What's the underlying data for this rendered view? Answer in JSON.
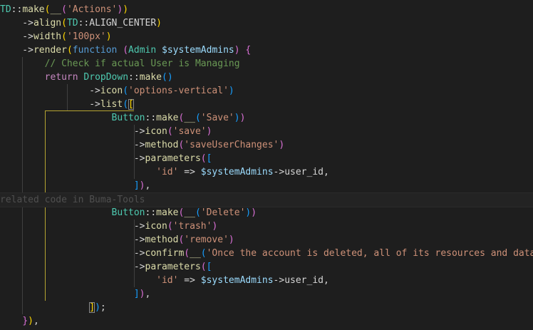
{
  "editor": {
    "language": "php",
    "theme_colors": {
      "background": "#1e1e1e",
      "type": "#4ec9b0",
      "function": "#dcdcaa",
      "string": "#ce9178",
      "variable": "#9cdcfe",
      "keyword": "#c586c0",
      "storage": "#569cd6",
      "comment": "#6a9955",
      "bracket_level_1": "#ffd700",
      "bracket_level_2": "#da70d6",
      "bracket_level_3": "#179fff",
      "active_indent_guide": "#b5a431"
    },
    "codelens_text": "related code in Buma-Tools",
    "lines": [
      [
        [
          "TD",
          "type"
        ],
        [
          "::",
          "op"
        ],
        [
          "make",
          "fn"
        ],
        [
          "(",
          "b1"
        ],
        [
          "__",
          "fn"
        ],
        [
          "(",
          "b2"
        ],
        [
          "'Actions'",
          "str"
        ],
        [
          ")",
          "b2"
        ],
        [
          ")",
          "b1"
        ]
      ],
      [
        [
          "    ->",
          "op"
        ],
        [
          "align",
          "fn"
        ],
        [
          "(",
          "b1"
        ],
        [
          "TD",
          "type"
        ],
        [
          "::ALIGN_CENTER",
          "op"
        ],
        [
          ")",
          "b1"
        ]
      ],
      [
        [
          "    ->",
          "op"
        ],
        [
          "width",
          "fn"
        ],
        [
          "(",
          "b1"
        ],
        [
          "'100px'",
          "str"
        ],
        [
          ")",
          "b1"
        ]
      ],
      [
        [
          "    ->",
          "op"
        ],
        [
          "render",
          "fn"
        ],
        [
          "(",
          "b1"
        ],
        [
          "function",
          "kw2"
        ],
        [
          " ",
          "op"
        ],
        [
          "(",
          "b2"
        ],
        [
          "Admin",
          "type"
        ],
        [
          " ",
          "op"
        ],
        [
          "$systemAdmins",
          "var"
        ],
        [
          ")",
          "b2"
        ],
        [
          " ",
          "op"
        ],
        [
          "{",
          "b2"
        ]
      ],
      [
        [
          "        ",
          "op"
        ],
        [
          "// Check if actual User is Managing",
          "comment"
        ]
      ],
      [
        [
          "        ",
          "op"
        ],
        [
          "return",
          "kw"
        ],
        [
          " ",
          "op"
        ],
        [
          "DropDown",
          "type"
        ],
        [
          "::",
          "op"
        ],
        [
          "make",
          "fn"
        ],
        [
          "(",
          "b3"
        ],
        [
          ")",
          "b3"
        ]
      ],
      [
        [
          "                ->",
          "op"
        ],
        [
          "icon",
          "fn"
        ],
        [
          "(",
          "b3"
        ],
        [
          "'options-vertical'",
          "str"
        ],
        [
          ")",
          "b3"
        ]
      ],
      [
        [
          "                ->",
          "op"
        ],
        [
          "list",
          "fn"
        ],
        [
          "(",
          "b3"
        ],
        [
          "[",
          "b1",
          "match"
        ]
      ],
      [
        [
          "                    ",
          "op"
        ],
        [
          "Button",
          "type"
        ],
        [
          "::",
          "op"
        ],
        [
          "make",
          "fn"
        ],
        [
          "(",
          "b2"
        ],
        [
          "__",
          "fn"
        ],
        [
          "(",
          "b3"
        ],
        [
          "'Save'",
          "str"
        ],
        [
          ")",
          "b3"
        ],
        [
          ")",
          "b2"
        ]
      ],
      [
        [
          "                        ->",
          "op"
        ],
        [
          "icon",
          "fn"
        ],
        [
          "(",
          "b2"
        ],
        [
          "'save'",
          "str"
        ],
        [
          ")",
          "b2"
        ]
      ],
      [
        [
          "                        ->",
          "op"
        ],
        [
          "method",
          "fn"
        ],
        [
          "(",
          "b2"
        ],
        [
          "'saveUserChanges'",
          "str"
        ],
        [
          ")",
          "b2"
        ]
      ],
      [
        [
          "                        ->",
          "op"
        ],
        [
          "parameters",
          "fn"
        ],
        [
          "(",
          "b2"
        ],
        [
          "[",
          "b3"
        ]
      ],
      [
        [
          "                            ",
          "op"
        ],
        [
          "'id'",
          "str"
        ],
        [
          " => ",
          "op"
        ],
        [
          "$systemAdmins",
          "var"
        ],
        [
          "->",
          "op"
        ],
        [
          "user_id",
          "op"
        ],
        [
          ",",
          "op"
        ]
      ],
      [
        [
          "                        ",
          "op"
        ],
        [
          "]",
          "b3"
        ],
        [
          ")",
          "b2"
        ],
        [
          ",",
          "op"
        ]
      ],
      "__CODELENS__",
      [
        [
          "                    ",
          "op"
        ],
        [
          "Button",
          "type"
        ],
        [
          "::",
          "op"
        ],
        [
          "make",
          "fn"
        ],
        [
          "(",
          "b2"
        ],
        [
          "__",
          "fn"
        ],
        [
          "(",
          "b3"
        ],
        [
          "'Delete'",
          "str"
        ],
        [
          ")",
          "b3"
        ],
        [
          ")",
          "b2"
        ]
      ],
      [
        [
          "                        ->",
          "op"
        ],
        [
          "icon",
          "fn"
        ],
        [
          "(",
          "b2"
        ],
        [
          "'trash'",
          "str"
        ],
        [
          ")",
          "b2"
        ]
      ],
      [
        [
          "                        ->",
          "op"
        ],
        [
          "method",
          "fn"
        ],
        [
          "(",
          "b2"
        ],
        [
          "'remove'",
          "str"
        ],
        [
          ")",
          "b2"
        ]
      ],
      [
        [
          "                        ->",
          "op"
        ],
        [
          "confirm",
          "fn"
        ],
        [
          "(",
          "b2"
        ],
        [
          "__",
          "fn"
        ],
        [
          "(",
          "b3"
        ],
        [
          "'Once the account is deleted, all of its resources and data will be permanently deleted.'",
          "str"
        ]
      ],
      [
        [
          "                        ->",
          "op"
        ],
        [
          "parameters",
          "fn"
        ],
        [
          "(",
          "b2"
        ],
        [
          "[",
          "b3"
        ]
      ],
      [
        [
          "                            ",
          "op"
        ],
        [
          "'id'",
          "str"
        ],
        [
          " => ",
          "op"
        ],
        [
          "$systemAdmins",
          "var"
        ],
        [
          "->",
          "op"
        ],
        [
          "user_id",
          "op"
        ],
        [
          ",",
          "op"
        ]
      ],
      [
        [
          "                        ",
          "op"
        ],
        [
          "]",
          "b3"
        ],
        [
          ")",
          "b2"
        ],
        [
          ",",
          "op"
        ]
      ],
      [
        [
          "                ",
          "op"
        ],
        [
          "]",
          "b1",
          "match"
        ],
        [
          ")",
          "b3"
        ],
        [
          ";",
          "op"
        ]
      ],
      [
        [
          "    ",
          "op"
        ],
        [
          "}",
          "b2"
        ],
        [
          ")",
          "b1"
        ],
        [
          ",",
          "op"
        ]
      ]
    ]
  }
}
